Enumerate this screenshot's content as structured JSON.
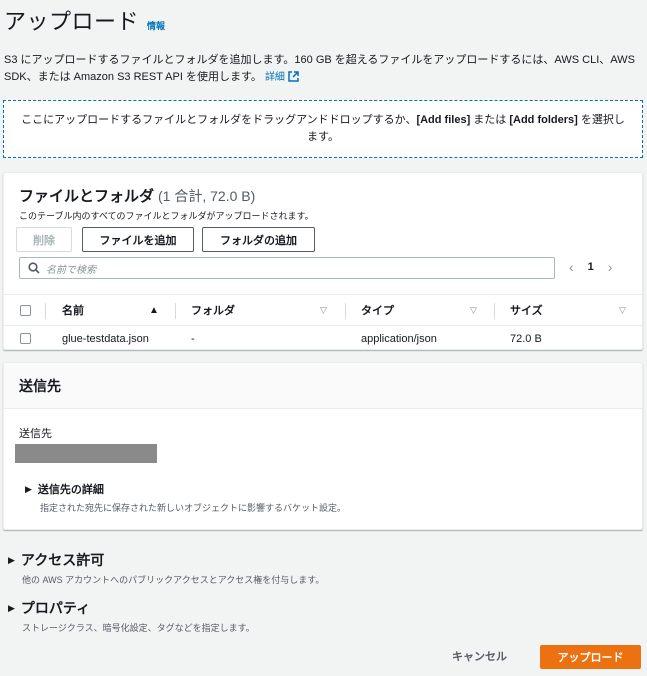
{
  "page": {
    "title": "アップロード",
    "info_link": "情報",
    "description": "S3 にアップロードするファイルとフォルダを追加します。160 GB を超えるファイルをアップロードするには、AWS CLI、AWS SDK、または Amazon S3 REST API を使用します。",
    "details_link": "詳細"
  },
  "dropzone": {
    "text_before": "ここにアップロードするファイルとフォルダをドラッグアンドドロップするか、",
    "add_files": "[Add files]",
    "middle": " または ",
    "add_folders": "[Add folders]",
    "text_after": " を選択します。"
  },
  "files_panel": {
    "title": "ファイルとフォルダ",
    "count": "(1 合計, 72.0 B)",
    "subtitle": "このテーブル内のすべてのファイルとフォルダがアップロードされます。",
    "delete_label": "削除",
    "add_files_label": "ファイルを追加",
    "add_folder_label": "フォルダの追加",
    "search_placeholder": "名前で検索",
    "page_number": "1",
    "columns": [
      "名前",
      "フォルダ",
      "タイプ",
      "サイズ"
    ],
    "rows": [
      {
        "name": "glue-testdata.json",
        "folder": "-",
        "type": "application/json",
        "size": "72.0 B"
      }
    ]
  },
  "destination": {
    "header": "送信先",
    "label": "送信先",
    "details_title": "送信先の詳細",
    "details_desc": "指定された宛先に保存された新しいオブジェクトに影響するバケット設定。"
  },
  "permissions": {
    "title": "アクセス許可",
    "desc": "他の AWS アカウントへのパブリックアクセスとアクセス権を付与します。"
  },
  "properties": {
    "title": "プロパティ",
    "desc": "ストレージクラス、暗号化設定、タグなどを指定します。"
  },
  "footer": {
    "cancel_label": "キャンセル",
    "upload_label": "アップロード"
  },
  "colors": {
    "accent": "#0073bb",
    "primary_button": "#ec7211",
    "background": "#f2f3f3"
  }
}
